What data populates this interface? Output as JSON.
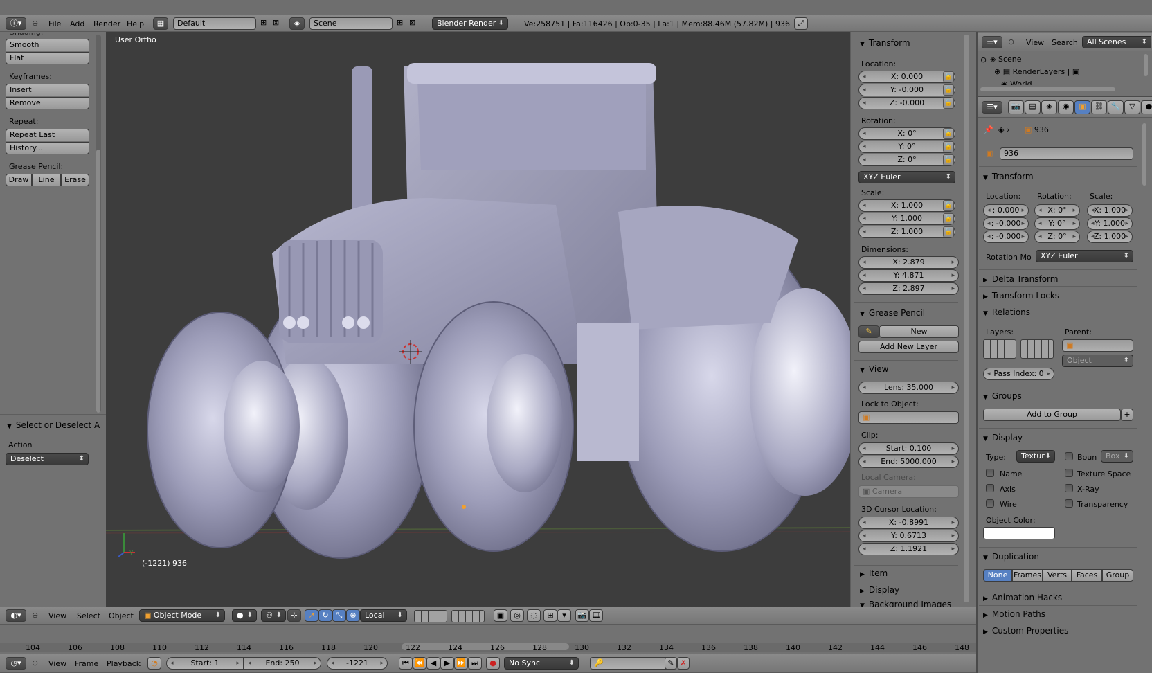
{
  "topbar": {
    "menus": [
      "File",
      "Add",
      "Render",
      "Help"
    ],
    "screen_layout": "Default",
    "scene": "Scene",
    "render_engine": "Blender Render",
    "stats": "Ve:258751 | Fa:116426 | Ob:0-35 | La:1 | Mem:88.46M (57.82M) | 936"
  },
  "toolshelf": {
    "top_clipped_label": "Shading:",
    "shading_buttons": [
      "Smooth",
      "Flat"
    ],
    "keyframes_label": "Keyframes:",
    "keyframe_buttons": [
      "Insert",
      "Remove"
    ],
    "repeat_label": "Repeat:",
    "repeat_buttons": [
      "Repeat Last",
      "History..."
    ],
    "grease_label": "Grease Pencil:",
    "grease_buttons": [
      "Draw",
      "Line",
      "Erase"
    ],
    "operator_title": "Select or Deselect A",
    "action_label": "Action",
    "action_value": "Deselect"
  },
  "viewport": {
    "view_name": "User Ortho",
    "object_info": "(-1221) 936"
  },
  "npanel": {
    "transform_title": "Transform",
    "location_label": "Location:",
    "location": [
      "X: 0.000",
      "Y: -0.000",
      "Z: -0.000"
    ],
    "rotation_label": "Rotation:",
    "rotation": [
      "X: 0°",
      "Y: 0°",
      "Z: 0°"
    ],
    "rotation_mode": "XYZ Euler",
    "scale_label": "Scale:",
    "scale": [
      "X: 1.000",
      "Y: 1.000",
      "Z: 1.000"
    ],
    "dimensions_label": "Dimensions:",
    "dimensions": [
      "X: 2.879",
      "Y: 4.871",
      "Z: 2.897"
    ],
    "grease_title": "Grease Pencil",
    "grease_new": "New",
    "grease_add_layer": "Add New Layer",
    "view_title": "View",
    "lens": "Lens: 35.000",
    "lock_to_object": "Lock to Object:",
    "clip_label": "Clip:",
    "clip_start": "Start: 0.100",
    "clip_end": "End: 5000.000",
    "local_camera": "Local Camera:",
    "camera": "Camera",
    "cursor_label": "3D Cursor Location:",
    "cursor": [
      "X: -0.8991",
      "Y: 0.6713",
      "Z: 1.1921"
    ],
    "item_title": "Item",
    "display_title": "Display",
    "background_title": "Background Images"
  },
  "outliner": {
    "menus": [
      "View",
      "Search"
    ],
    "filter": "All Scenes",
    "items": [
      "Scene",
      "RenderLayers",
      "World"
    ]
  },
  "properties": {
    "breadcrumb": "936",
    "object_name": "936",
    "transform_title": "Transform",
    "location_label": "Location:",
    "rotation_label": "Rotation:",
    "scale_label": "Scale:",
    "location": [
      ": 0.000",
      ": -0.000",
      ": -0.000"
    ],
    "rotation": [
      "X: 0°",
      "Y: 0°",
      "Z: 0°"
    ],
    "scale": [
      "X: 1.000",
      "Y: 1.000",
      "Z: 1.000"
    ],
    "rotation_mode_label": "Rotation Mo",
    "rotation_mode": "XYZ Euler",
    "delta_transform": "Delta Transform",
    "transform_locks": "Transform Locks",
    "relations_title": "Relations",
    "layers_label": "Layers:",
    "parent_label": "Parent:",
    "parent_type": "Object",
    "pass_index": "Pass Index: 0",
    "groups_title": "Groups",
    "add_to_group": "Add to Group",
    "display_title": "Display",
    "type_label": "Type:",
    "type_value": "Textur",
    "bounds_label": "Boun",
    "bounds_type": "Box",
    "checks_left": [
      "Name",
      "Axis",
      "Wire"
    ],
    "checks_right": [
      "Texture Space",
      "X-Ray",
      "Transparency"
    ],
    "object_color_label": "Object Color:",
    "duplication_title": "Duplication",
    "duplication_options": [
      "None",
      "Frames",
      "Verts",
      "Faces",
      "Group"
    ],
    "collapsed": [
      "Animation Hacks",
      "Motion Paths",
      "Custom Properties"
    ]
  },
  "view3d_header": {
    "menus": [
      "View",
      "Select",
      "Object"
    ],
    "mode": "Object Mode",
    "orientation": "Local"
  },
  "timeline": {
    "ticks": [
      "104",
      "106",
      "108",
      "110",
      "112",
      "114",
      "116",
      "118",
      "120",
      "122",
      "124",
      "126",
      "128",
      "130",
      "132",
      "134",
      "136",
      "138",
      "140",
      "142",
      "144",
      "146",
      "148"
    ],
    "menus": [
      "View",
      "Frame",
      "Playback"
    ],
    "start": "Start: 1",
    "end": "End: 250",
    "current": "-1221",
    "sync": "No Sync"
  },
  "colors": {
    "panel_bg": "#727272",
    "viewport_bg": "#3d3d3d",
    "selected_blue": "#5680c2",
    "model": "#a9a9c4"
  }
}
